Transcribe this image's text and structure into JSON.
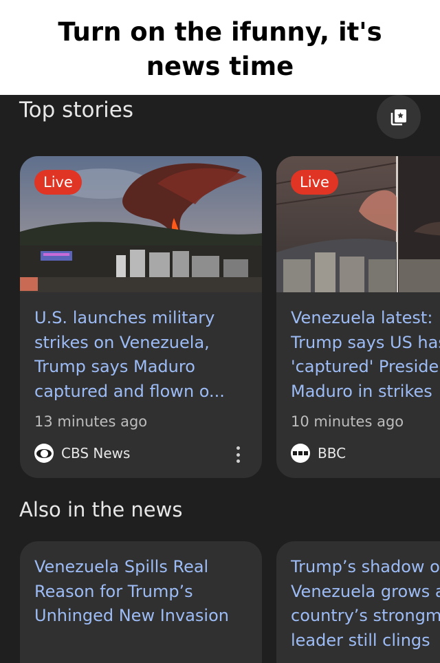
{
  "meme": {
    "caption": "Turn on the ifunny, it's news time"
  },
  "top_stories": {
    "title": "Top stories",
    "bookmark_icon": "saved-stories-icon",
    "cards": [
      {
        "badge": "Live",
        "headline": "U.S. launches military\nstrikes on Venezuela,\nTrump says Maduro\ncaptured and flown o...",
        "time": "13 minutes ago",
        "source": "CBS News",
        "source_icon": "cbs-eye-logo"
      },
      {
        "badge": "Live",
        "headline": "Venezuela latest:\nTrump says US has\n'captured' President\nMaduro in strikes",
        "time": "10 minutes ago",
        "source": "BBC",
        "source_icon": "bbc-logo"
      }
    ]
  },
  "also_in_news": {
    "title": "Also in the news",
    "cards": [
      {
        "headline": "Venezuela Spills Real\nReason for Trump’s\nUnhinged New Invasion"
      },
      {
        "headline": "Trump’s shadow over\nVenezuela grows as\ncountry’s strongman\nleader still clings"
      }
    ]
  },
  "colors": {
    "background": "#1f1f1f",
    "card": "#303030",
    "headline": "#9dbcf5",
    "live_badge": "#e03424"
  }
}
